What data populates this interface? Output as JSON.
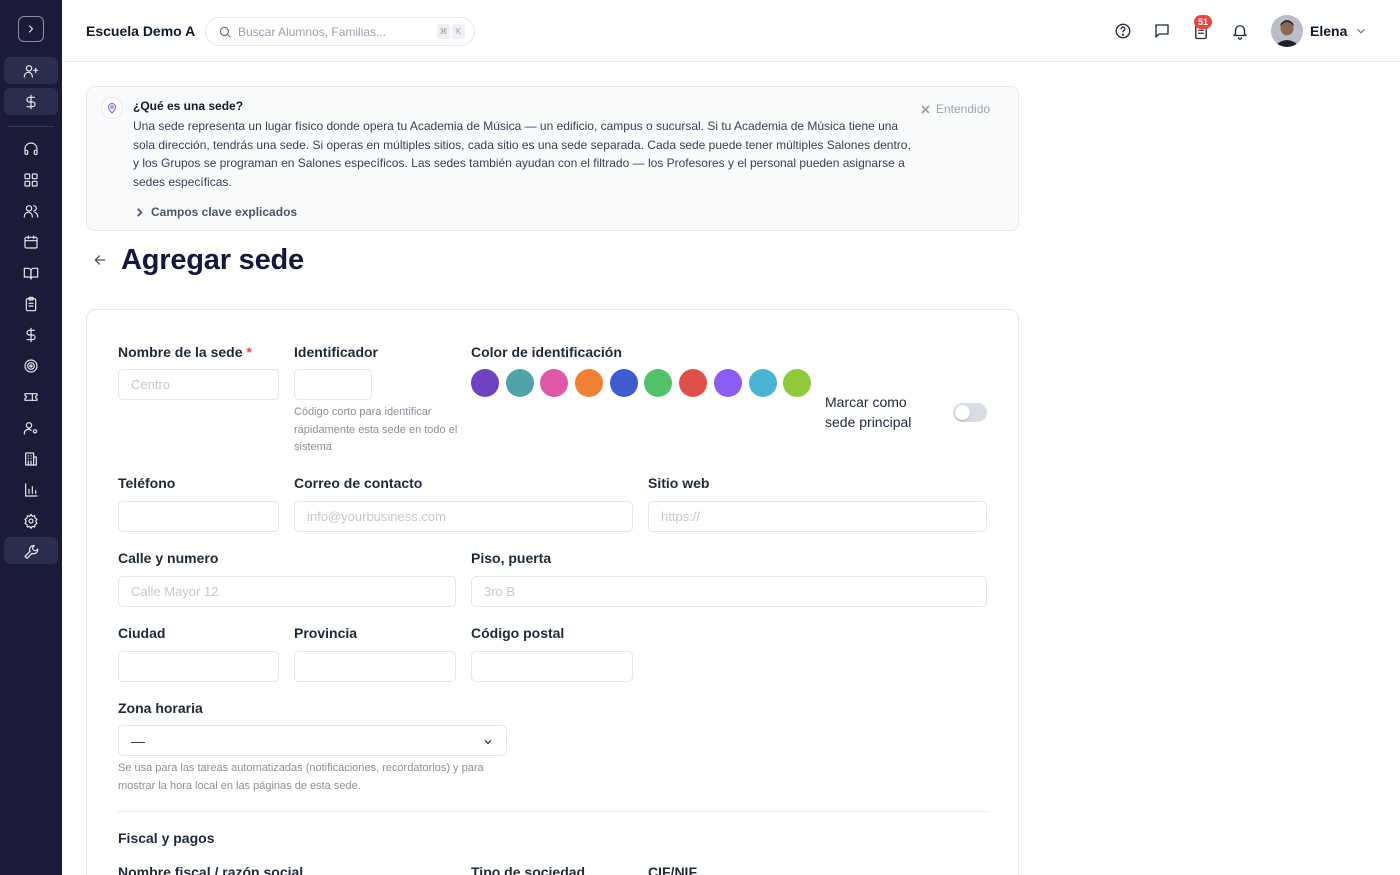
{
  "header": {
    "school_name": "Escuela Demo A",
    "search_placeholder": "Buscar Alumnos, Familias...",
    "search_kbd": [
      "⌘",
      "K"
    ],
    "notification_count": "51",
    "user_name": "Elena"
  },
  "banner": {
    "title": "¿Qué es una sede?",
    "text": "Una sede representa un lugar físico donde opera tu Academia de Música — un edificio, campus o sucursal. Si tu Academia de Música tiene una sola dirección, tendrás una sede. Si operas en múltiples sitios, cada sitio es una sede separada. Cada sede puede tener múltiples Salones dentro, y los Grupos se programan en Salones específicos. Las sedes también ayudan con el filtrado — los Profesores y el personal pueden asignarse a sedes específicas.",
    "dismiss_label": "Entendido",
    "more_label": "Campos clave explicados"
  },
  "page": {
    "title": "Agregar sede"
  },
  "form": {
    "name_label": "Nombre de la sede",
    "name_required": "*",
    "name_placeholder": "Centro",
    "identifier_label": "Identificador",
    "identifier_hint": "Código corto para identificar rápidamente esta sede en todo el sistema",
    "color_label": "Color de identificación",
    "colors": [
      "#6f42c1",
      "#4ea3a8",
      "#e056a8",
      "#f08034",
      "#3f5bd0",
      "#52c26a",
      "#e0504a",
      "#8b5cf6",
      "#4bb3d4",
      "#8fc93a"
    ],
    "primary_label": "Marcar como sede principal",
    "primary_on": false,
    "phone_label": "Teléfono",
    "email_label": "Correo de contacto",
    "email_placeholder": "info@yourbusiness.com",
    "website_label": "Sitio web",
    "website_placeholder": "https://",
    "street_label": "Calle y numero",
    "street_placeholder": "Calle Mayor 12",
    "floor_label": "Piso, puerta",
    "floor_placeholder": "3ro B",
    "city_label": "Ciudad",
    "province_label": "Provincia",
    "postal_label": "Código postal",
    "timezone_label": "Zona horaria",
    "timezone_value": "—",
    "timezone_hint": "Se usa para las tareas automatizadas (notificaciones, recordatorios) y para mostrar la hora local en las páginas de esta sede.",
    "fiscal_title": "Fiscal y pagos",
    "fiscal_name_label": "Nombre fiscal / razón social",
    "company_type_label": "Tipo de sociedad",
    "cif_label": "CIF/NIF"
  },
  "sidebar": {
    "items": [
      "add-user",
      "payments",
      "support",
      "dashboard",
      "contacts",
      "calendar",
      "courses",
      "attendance",
      "billing",
      "goals",
      "tickets",
      "staff",
      "locations",
      "reports",
      "settings",
      "tools"
    ]
  }
}
